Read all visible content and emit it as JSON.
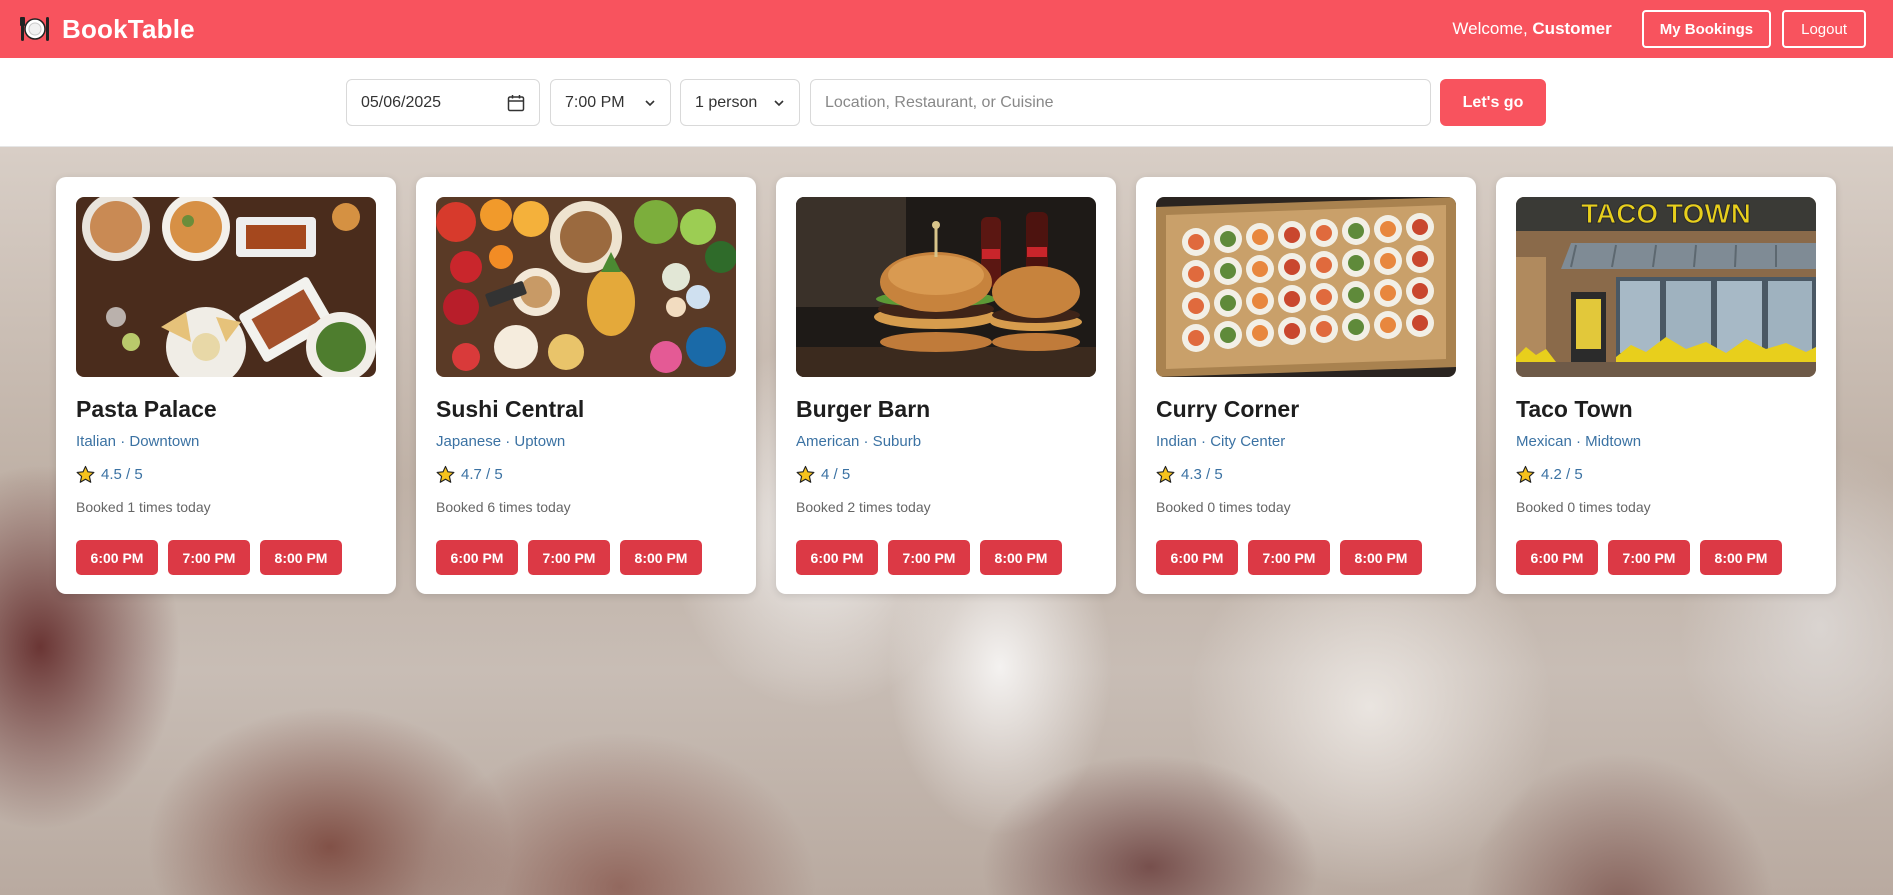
{
  "header": {
    "brand": "BookTable",
    "brand_icon": "plate-fork-knife-icon",
    "welcome_prefix": "Welcome, ",
    "welcome_user": "Customer",
    "my_bookings_label": "My Bookings",
    "logout_label": "Logout",
    "bg_color": "#f8535e"
  },
  "search": {
    "date_value": "05/06/2025",
    "time_value": "7:00 PM",
    "party_value": "1 person",
    "query_placeholder": "Location, Restaurant, or Cuisine",
    "submit_label": "Let's go"
  },
  "restaurants": [
    {
      "name": "Pasta Palace",
      "meta": "Italian · Downtown",
      "rating": "4.5 / 5",
      "booked": "Booked 1 times today",
      "slots": [
        "6:00 PM",
        "7:00 PM",
        "8:00 PM"
      ]
    },
    {
      "name": "Sushi Central",
      "meta": "Japanese · Uptown",
      "rating": "4.7 / 5",
      "booked": "Booked 6 times today",
      "slots": [
        "6:00 PM",
        "7:00 PM",
        "8:00 PM"
      ]
    },
    {
      "name": "Burger Barn",
      "meta": "American · Suburb",
      "rating": "4 / 5",
      "booked": "Booked 2 times today",
      "slots": [
        "6:00 PM",
        "7:00 PM",
        "8:00 PM"
      ]
    },
    {
      "name": "Curry Corner",
      "meta": "Indian · City Center",
      "rating": "4.3 / 5",
      "booked": "Booked 0 times today",
      "slots": [
        "6:00 PM",
        "7:00 PM",
        "8:00 PM"
      ]
    },
    {
      "name": "Taco Town",
      "meta": "Mexican · Midtown",
      "rating": "4.2 / 5",
      "booked": "Booked 0 times today",
      "slots": [
        "6:00 PM",
        "7:00 PM",
        "8:00 PM"
      ],
      "sign_text": "TACO TOWN"
    }
  ],
  "colors": {
    "accent": "#f8535e",
    "slot_button": "#dc3945",
    "meta_text": "#3b72a3"
  }
}
